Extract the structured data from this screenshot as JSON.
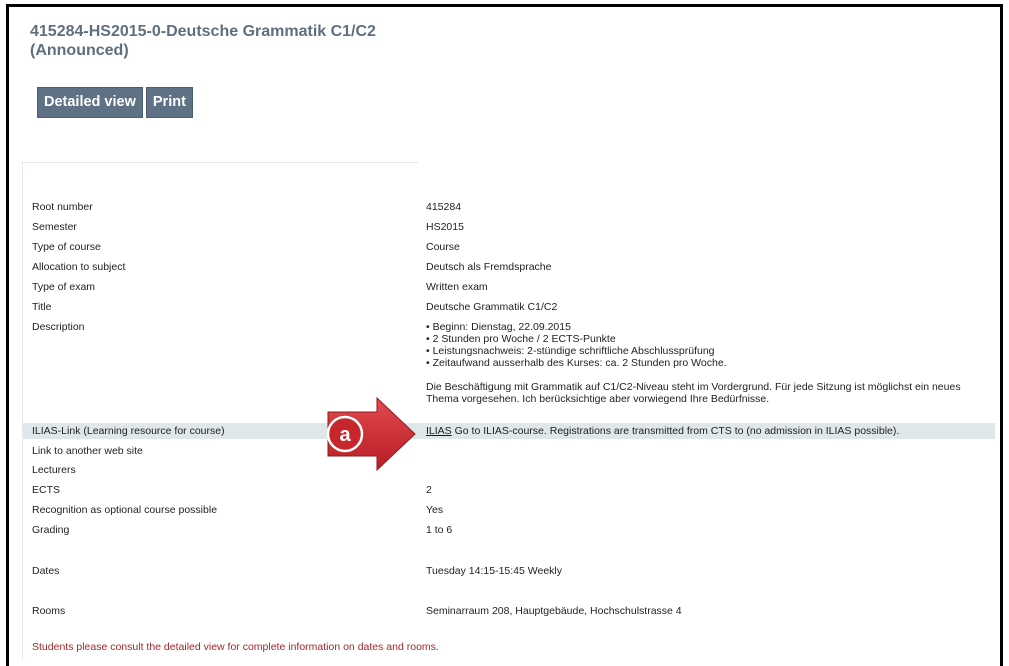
{
  "course_title": "415284-HS2015-0-Deutsche Grammatik C1/C2 (Announced)",
  "buttons": {
    "detailed_view": "Detailed view",
    "print": "Print"
  },
  "details": {
    "root_number": {
      "label": "Root number",
      "value": "415284"
    },
    "semester": {
      "label": "Semester",
      "value": "HS2015"
    },
    "type_of_course": {
      "label": "Type of course",
      "value": "Course"
    },
    "allocation": {
      "label": "Allocation to subject",
      "value": "Deutsch als Fremdsprache"
    },
    "type_of_exam": {
      "label": "Type of exam",
      "value": "Written exam"
    },
    "title": {
      "label": "Title",
      "value": "Deutsche Grammatik C1/C2"
    },
    "description": {
      "label": "Description",
      "bullets": [
        "• Beginn: Dienstag, 22.09.2015",
        "• 2 Stunden pro Woche / 2 ECTS-Punkte",
        "• Leistungsnachweis: 2-stündige schriftliche Abschlussprüfung",
        "• Zeitaufwand ausserhalb des Kurses: ca. 2 Stunden pro Woche."
      ],
      "paragraph": "Die Beschäftigung mit Grammatik auf C1/C2-Niveau steht im Vordergrund. Für jede Sitzung ist möglichst ein neues Thema vorgesehen. Ich berücksichtige aber vorwiegend Ihre Bedürfnisse."
    },
    "ilias": {
      "label": "ILIAS-Link (Learning resource for course)",
      "link_text": "ILIAS",
      "text": " Go to ILIAS-course. Registrations are transmitted from CTS to (no admission in ILIAS possible)."
    },
    "web_link": {
      "label": "Link to another web site",
      "value": ""
    },
    "lecturers": {
      "label": "Lecturers",
      "value": ""
    },
    "ects": {
      "label": "ECTS",
      "value": "2"
    },
    "recognition": {
      "label": "Recognition as optional course possible",
      "value": "Yes"
    },
    "grading": {
      "label": "Grading",
      "value": "1 to 6"
    },
    "dates": {
      "label": "Dates",
      "value": "Tuesday 14:15-15:45 Weekly"
    },
    "rooms": {
      "label": "Rooms",
      "value": "Seminarraum 208, Hauptgebäude, Hochschulstrasse 4"
    }
  },
  "footer_note": "Students please consult the detailed view for complete information on dates and rooms.",
  "annotation": {
    "label": "a",
    "color": "#c8262d"
  }
}
